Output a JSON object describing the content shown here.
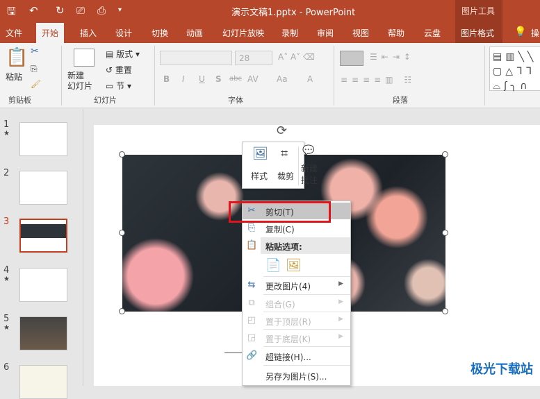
{
  "title": "演示文稿1.pptx  -  PowerPoint",
  "picture_tools": "图片工具",
  "tabs": [
    "文件",
    "开始",
    "插入",
    "设计",
    "切换",
    "动画",
    "幻灯片放映",
    "录制",
    "审阅",
    "视图",
    "帮助",
    "云盘",
    "图片格式",
    "操"
  ],
  "ribbon": {
    "paste": "粘贴",
    "clipboard": "剪贴板",
    "new_slide": "新建\n幻灯片",
    "layout": "版式",
    "reset": "重置",
    "section": "节",
    "slides": "幻灯片",
    "font_size": "28",
    "font": "字体",
    "paragraph": "段落",
    "bold": "B",
    "italic": "I",
    "underline": "U",
    "shadow": "S",
    "strike": "abc",
    "spacing": "AV",
    "case": "Aa",
    "fontcolor": "A"
  },
  "slides": [
    "1",
    "2",
    "3",
    "4",
    "5",
    "6"
  ],
  "mini_toolbar": {
    "style": "样式",
    "crop": "裁剪",
    "new_comment_1": "新建",
    "new_comment_2": "批注"
  },
  "context_menu": {
    "cut": "剪切(T)",
    "copy": "复制(C)",
    "paste_options": "粘贴选项:",
    "change_picture": "更改图片(4)",
    "group": "组合(G)",
    "bring_front": "置于顶层(R)",
    "send_back": "置于底层(K)",
    "hyperlink": "超链接(H)...",
    "save_as_picture": "另存为图片(S)..."
  },
  "watermark": "极光下载站"
}
